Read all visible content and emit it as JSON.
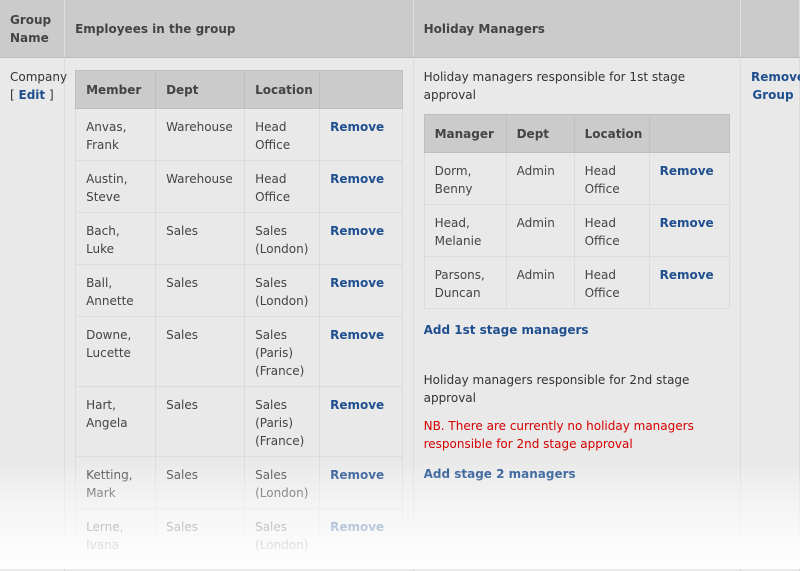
{
  "header": {
    "group_name": "Group Name",
    "employees": "Employees in the group",
    "holiday_managers": "Holiday Managers"
  },
  "group": {
    "name": "Company",
    "edit_open": "[",
    "edit_label": "Edit",
    "edit_close": "]",
    "remove_group_label": "Remove Group"
  },
  "members": {
    "columns": [
      "Member",
      "Dept",
      "Location",
      ""
    ],
    "remove_label": "Remove",
    "rows": [
      {
        "name": "Anvas, Frank",
        "dept": "Warehouse",
        "location": "Head Office"
      },
      {
        "name": "Austin, Steve",
        "dept": "Warehouse",
        "location": "Head Office"
      },
      {
        "name": "Bach, Luke",
        "dept": "Sales",
        "location": "Sales (London)"
      },
      {
        "name": "Ball, Annette",
        "dept": "Sales",
        "location": "Sales (London)"
      },
      {
        "name": "Downe, Lucette",
        "dept": "Sales",
        "location": "Sales (Paris) (France)"
      },
      {
        "name": "Hart, Angela",
        "dept": "Sales",
        "location": "Sales (Paris) (France)"
      },
      {
        "name": "Ketting, Mark",
        "dept": "Sales",
        "location": "Sales (London)"
      },
      {
        "name": "Lerne, Ivana",
        "dept": "Sales",
        "location": "Sales (London)"
      }
    ]
  },
  "stage1": {
    "description": "Holiday managers responsible for 1st stage approval",
    "columns": [
      "Manager",
      "Dept",
      "Location",
      ""
    ],
    "remove_label": "Remove",
    "rows": [
      {
        "name": "Dorm, Benny",
        "dept": "Admin",
        "location": "Head Office"
      },
      {
        "name": "Head, Melanie",
        "dept": "Admin",
        "location": "Head Office"
      },
      {
        "name": "Parsons, Duncan",
        "dept": "Admin",
        "location": "Head Office"
      }
    ],
    "add_label": "Add 1st stage managers"
  },
  "stage2": {
    "description": "Holiday managers responsible for 2nd stage approval",
    "warning": "NB. There are currently no holiday managers responsible for 2nd stage approval",
    "add_label": "Add stage 2 managers"
  },
  "colors": {
    "link": "#1f4f8f",
    "warning": "#d40000",
    "header_bg": "#cbcbcb",
    "body_bg": "#e9e9e9"
  }
}
